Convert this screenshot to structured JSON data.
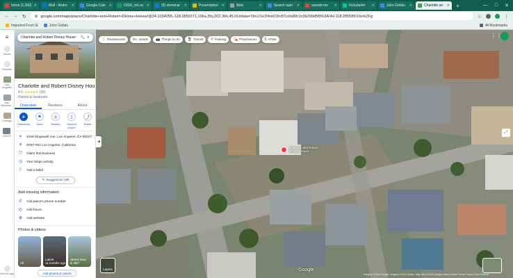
{
  "browser": {
    "tabs": [
      {
        "label": "Inbox (2,360)",
        "color": "#ea4335"
      },
      {
        "label": "Mail - Andre",
        "color": "#0078d4"
      },
      {
        "label": "Google Cale",
        "color": "#4285f4"
      },
      {
        "label": "OSW_onLoc",
        "color": "#0f9d58"
      },
      {
        "label": "(8) streetcar",
        "color": "#1877f2"
      },
      {
        "label": "Presentation",
        "color": "#f4b400"
      },
      {
        "label": "Atris",
        "color": "#9e9e9e"
      },
      {
        "label": "Search oper",
        "color": "#4285f4"
      },
      {
        "label": "oswald mo",
        "color": "#ea4335"
      },
      {
        "label": "Kickstarter",
        "color": "#05ce78"
      },
      {
        "label": "John Gefalu",
        "color": "#4285f4"
      },
      {
        "label": "Charlotte an",
        "color": "#34a853"
      }
    ],
    "active_tab": 11,
    "url": "google.com/maps/place/Charlotte+and+Robert+Disney+House/@34.1034055,-118.2850271,106a,35y,202.36h,45.01t/data=!3m1!1e3!4m6!3m5!1s0x80c2c0b299d5f0%3A!4d-118.285595!16s%2Fg",
    "bookmarks": [
      {
        "label": "Imported From IE"
      },
      {
        "label": "John Gefalu"
      }
    ],
    "all_bookmarks": "All Bookmarks"
  },
  "rail": {
    "items": [
      {
        "label": "Saved"
      },
      {
        "label": "Recents"
      },
      {
        "label": "Los Angeles"
      },
      {
        "label": "San Bernardi..."
      },
      {
        "label": "Chicago"
      },
      {
        "label": "ERICS"
      }
    ],
    "get_app": "Get the app"
  },
  "search": {
    "query": "Charlotte and Robert Disney House"
  },
  "place": {
    "name": "Charlotte and Robert Disney House",
    "rating": "4.6",
    "stars": "★★★★★",
    "review_count": "(26)",
    "category": "Historical landmark",
    "tabs": [
      "Overview",
      "Reviews",
      "About"
    ],
    "actions": [
      "Directions",
      "Save",
      "Nearby",
      "Send to phone",
      "Share"
    ],
    "address": "4406 Kingswell Ave, Los Angeles, CA 90027",
    "plus_code": "4P57+M2 Los Angeles, California",
    "claim": "Claim this business",
    "timeline": "Your Maps activity",
    "add_label": "Add a label",
    "suggest_edit": "Suggest an edit",
    "missing_heading": "Add missing information",
    "missing": [
      "Add place's phone number",
      "Add hours",
      "Add website"
    ],
    "photos_heading": "Photos & videos",
    "photos": [
      {
        "caption": "All"
      },
      {
        "caption": "Latest",
        "sub": "11 months ago"
      },
      {
        "caption": "Street View",
        "sub": "& 360°"
      }
    ],
    "add_photos": "Add photos & videos"
  },
  "map": {
    "chips": [
      {
        "label": "Restaurants",
        "icon": "🍴"
      },
      {
        "label": "Hotels",
        "icon": "🛏"
      },
      {
        "label": "Things to do",
        "icon": "📷"
      },
      {
        "label": "Transit",
        "icon": "🚆"
      },
      {
        "label": "Parking",
        "icon": "P"
      },
      {
        "label": "Pharmacies",
        "icon": "💊"
      },
      {
        "label": "ATMs",
        "icon": "$"
      }
    ],
    "pin_label": "Charlotte and Robert Disney House",
    "layers_label": "Layers",
    "google": "Google",
    "attribution": "Imagery ©2024 Google, Imagery ©2024 Airbus, Map data ©2024 Google  United States  Terms  Privacy  Send Product Feedback  20 m"
  }
}
